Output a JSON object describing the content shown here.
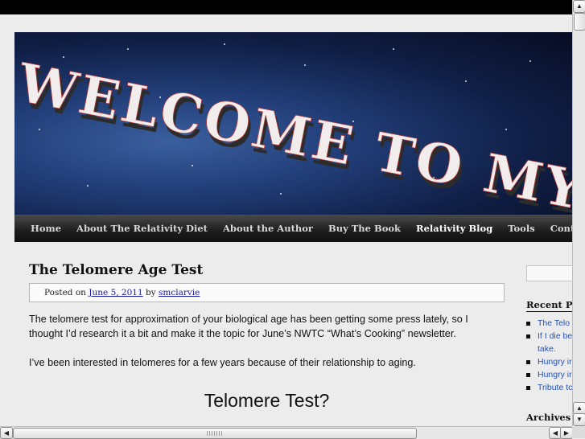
{
  "banner": {
    "text": "WELCOME TO MY W"
  },
  "nav": {
    "items": [
      {
        "label": "Home",
        "active": false
      },
      {
        "label": "About The Relativity Diet",
        "active": false
      },
      {
        "label": "About the Author",
        "active": false
      },
      {
        "label": "Buy The Book",
        "active": false
      },
      {
        "label": "Relativity Blog",
        "active": true
      },
      {
        "label": "Tools",
        "active": false
      },
      {
        "label": "Contact",
        "active": false
      }
    ]
  },
  "post": {
    "title": "The Telomere Age Test",
    "meta_prefix": "Posted on",
    "date": "June 5, 2011",
    "by": "by",
    "author": "smclarvie",
    "paragraph1": "The telomere test for approximation of your biological age has been getting some press lately, so I thought I’d research it a bit and make it the topic for June’s NWTC “What’s Cooking” newsletter.",
    "paragraph2": "I’ve been interested in telomeres for a few years because of their relationship to aging.",
    "heading": "Telomere Test?"
  },
  "sidebar": {
    "recent_posts_heading": "Recent Pos",
    "recent_posts": [
      {
        "line1": "The Telo",
        "line2": ""
      },
      {
        "line1": "If I die be",
        "line2": "take."
      },
      {
        "line1": "Hungry ir",
        "line2": ""
      },
      {
        "line1": "Hungry ir",
        "line2": ""
      },
      {
        "line1": "Tribute tc",
        "line2": ""
      }
    ],
    "archives_heading": "Archives"
  },
  "scrollbars": {
    "up_icon": "▲",
    "down_icon": "▼",
    "left_icon": "◀",
    "right_icon": "▶"
  }
}
